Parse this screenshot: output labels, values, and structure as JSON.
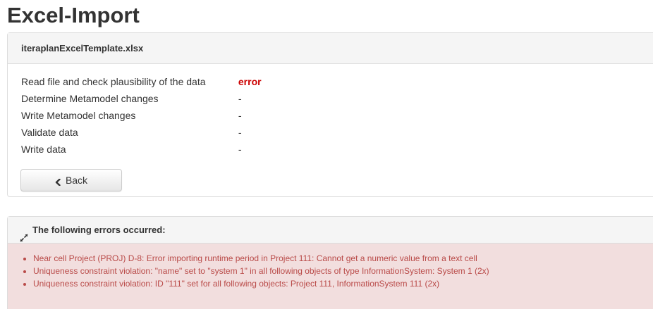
{
  "page": {
    "title": "Excel-Import"
  },
  "import_panel": {
    "file_name": "iteraplanExcelTemplate.xlsx",
    "steps": [
      {
        "label": "Read file and check plausibility of the data",
        "status": "error"
      },
      {
        "label": "Determine Metamodel changes",
        "status": "-"
      },
      {
        "label": "Write Metamodel changes",
        "status": "-"
      },
      {
        "label": "Validate data",
        "status": "-"
      },
      {
        "label": "Write data",
        "status": "-"
      }
    ],
    "back_label": "Back"
  },
  "errors_panel": {
    "heading": "The following errors occurred:",
    "errors": [
      "Near cell Project (PROJ) D-8: Error importing runtime period in Project 111: Cannot get a numeric value from a text cell",
      "Uniqueness constraint violation: \"name\" set to \"system 1\" in all following objects of type InformationSystem: System 1 (2x)",
      "Uniqueness constraint violation: ID \"111\" set for all following objects: Project 111, InformationSystem 111 (2x)"
    ]
  },
  "colors": {
    "error_text": "#cc0000",
    "error_list_text": "#b94a48",
    "error_background": "#f2dede",
    "panel_heading_background": "#f5f5f5"
  },
  "icons": {
    "back": "chevron-left-icon",
    "errors_toggle": "expand-arrows-icon"
  }
}
